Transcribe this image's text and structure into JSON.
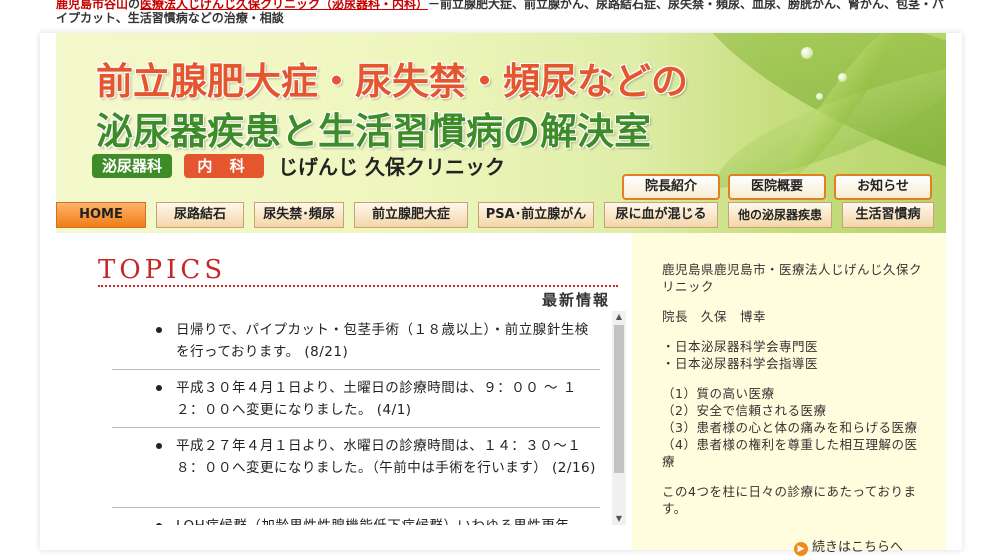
{
  "topline": {
    "prefix": "鹿児島市谷山",
    "no": "の",
    "link": "医療法人じげんじ久保クリニック（泌尿器科・内科）",
    "suffix": "－前立腺肥大症、前立腺がん、尿路結石症、尿失禁・頻尿、血尿、膀胱がん、腎がん、包茎・パイプカット、生活習慣病などの治療・相談"
  },
  "header": {
    "title_line1": "前立腺肥大症・尿失禁・頻尿などの",
    "title_line2": "泌尿器疾患と生活習慣病の解決室",
    "badge_urology": "泌尿器科",
    "badge_internal": "内 科",
    "clinic_name": "じげんじ 久保クリニック"
  },
  "subnav": [
    {
      "label": "院長紹介"
    },
    {
      "label": "医院概要"
    },
    {
      "label": "お知らせ"
    }
  ],
  "nav": [
    {
      "label": "HOME"
    },
    {
      "label": "尿路結石"
    },
    {
      "label": "尿失禁･頻尿"
    },
    {
      "label": "前立腺肥大症"
    },
    {
      "label": "PSA･前立腺がん"
    },
    {
      "label": "尿に血が混じる"
    },
    {
      "label": "他の泌尿器疾患"
    },
    {
      "label": "生活習慣病"
    }
  ],
  "topics": {
    "title": "TOPICS",
    "subtitle": "最新情報",
    "items": [
      {
        "text": "日帰りで、パイプカット・包茎手術（１８歳以上）・前立腺針生検を行っております。 (8/21)"
      },
      {
        "text": "平成３０年４月１日より、土曜日の診療時間は、９：００ ～ １２：００へ変更になりました。 (4/1)"
      },
      {
        "text": "平成２７年４月１日より、水曜日の診療時間は、１４：３０～１８：００へ変更になりました。（午前中は手術を行います） (2/16)"
      },
      {
        "text": "LOH症候群（加齢男性性腺機能低下症候群）いわゆる男性更年"
      }
    ]
  },
  "sidebar": {
    "intro": "鹿児島県鹿児島市・医療法人じげんじ久保クリニック",
    "director": "院長　久保　博幸",
    "quals": [
      "・日本泌尿器科学会専門医",
      "・日本泌尿器科学会指導医"
    ],
    "principles": [
      "（1）質の高い医療",
      "（2）安全で信頼される医療",
      "（3）患者様の心と体の痛みを和らげる医療",
      "（4）患者様の権利を尊重した相互理解の医療"
    ],
    "closing": "この4つを柱に日々の診療にあたっております。",
    "more": "続きはこちらへ"
  }
}
